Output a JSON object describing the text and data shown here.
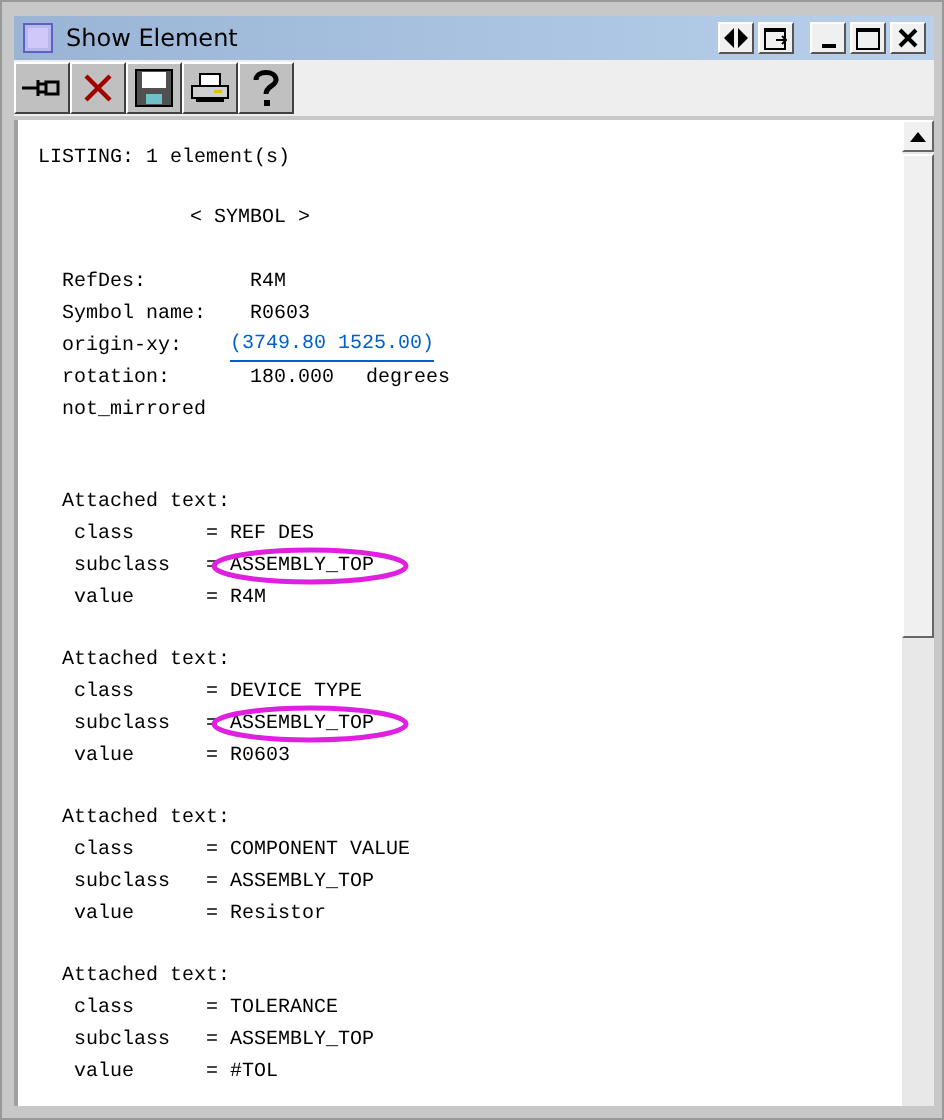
{
  "window": {
    "title": "Show Element"
  },
  "toolbar": [
    {
      "kind": "pin"
    },
    {
      "kind": "delete"
    },
    {
      "kind": "save"
    },
    {
      "kind": "print"
    },
    {
      "kind": "help"
    }
  ],
  "listing": {
    "header": "LISTING: 1 element(s)",
    "symbol_header": "< SYMBOL >",
    "properties": [
      {
        "label": "RefDes:",
        "value": "R4M",
        "kind": "text"
      },
      {
        "label": "Symbol name:",
        "value": "R0603",
        "kind": "text"
      },
      {
        "label": "origin-xy:",
        "value": "(3749.80 1525.00)",
        "kind": "link"
      },
      {
        "label": "rotation:",
        "value": "180.000",
        "unit": "degrees",
        "kind": "text"
      },
      {
        "label": "not_mirrored",
        "kind": "flag"
      }
    ],
    "attached_texts": [
      {
        "heading": "Attached text:",
        "fields": [
          {
            "name": "class",
            "separator": "=",
            "value": "REF DES",
            "highlighted": false
          },
          {
            "name": "subclass",
            "separator": "=",
            "value": "ASSEMBLY_TOP",
            "highlighted": true
          },
          {
            "name": "value",
            "separator": "=",
            "value": "R4M",
            "highlighted": false
          }
        ]
      },
      {
        "heading": "Attached text:",
        "fields": [
          {
            "name": "class",
            "separator": "=",
            "value": "DEVICE TYPE",
            "highlighted": false
          },
          {
            "name": "subclass",
            "separator": "=",
            "value": "ASSEMBLY_TOP",
            "highlighted": true
          },
          {
            "name": "value",
            "separator": "=",
            "value": "R0603",
            "highlighted": false
          }
        ]
      },
      {
        "heading": "Attached text:",
        "fields": [
          {
            "name": "class",
            "separator": "=",
            "value": "COMPONENT VALUE",
            "highlighted": false
          },
          {
            "name": "subclass",
            "separator": "=",
            "value": "ASSEMBLY_TOP",
            "highlighted": false
          },
          {
            "name": "value",
            "separator": "=",
            "value": "Resistor",
            "highlighted": false
          }
        ]
      },
      {
        "heading": "Attached text:",
        "fields": [
          {
            "name": "class",
            "separator": "=",
            "value": "TOLERANCE",
            "highlighted": false
          },
          {
            "name": "subclass",
            "separator": "=",
            "value": "ASSEMBLY_TOP",
            "highlighted": false
          },
          {
            "name": "value",
            "separator": "=",
            "value": "#TOL",
            "highlighted": false
          }
        ]
      }
    ]
  }
}
